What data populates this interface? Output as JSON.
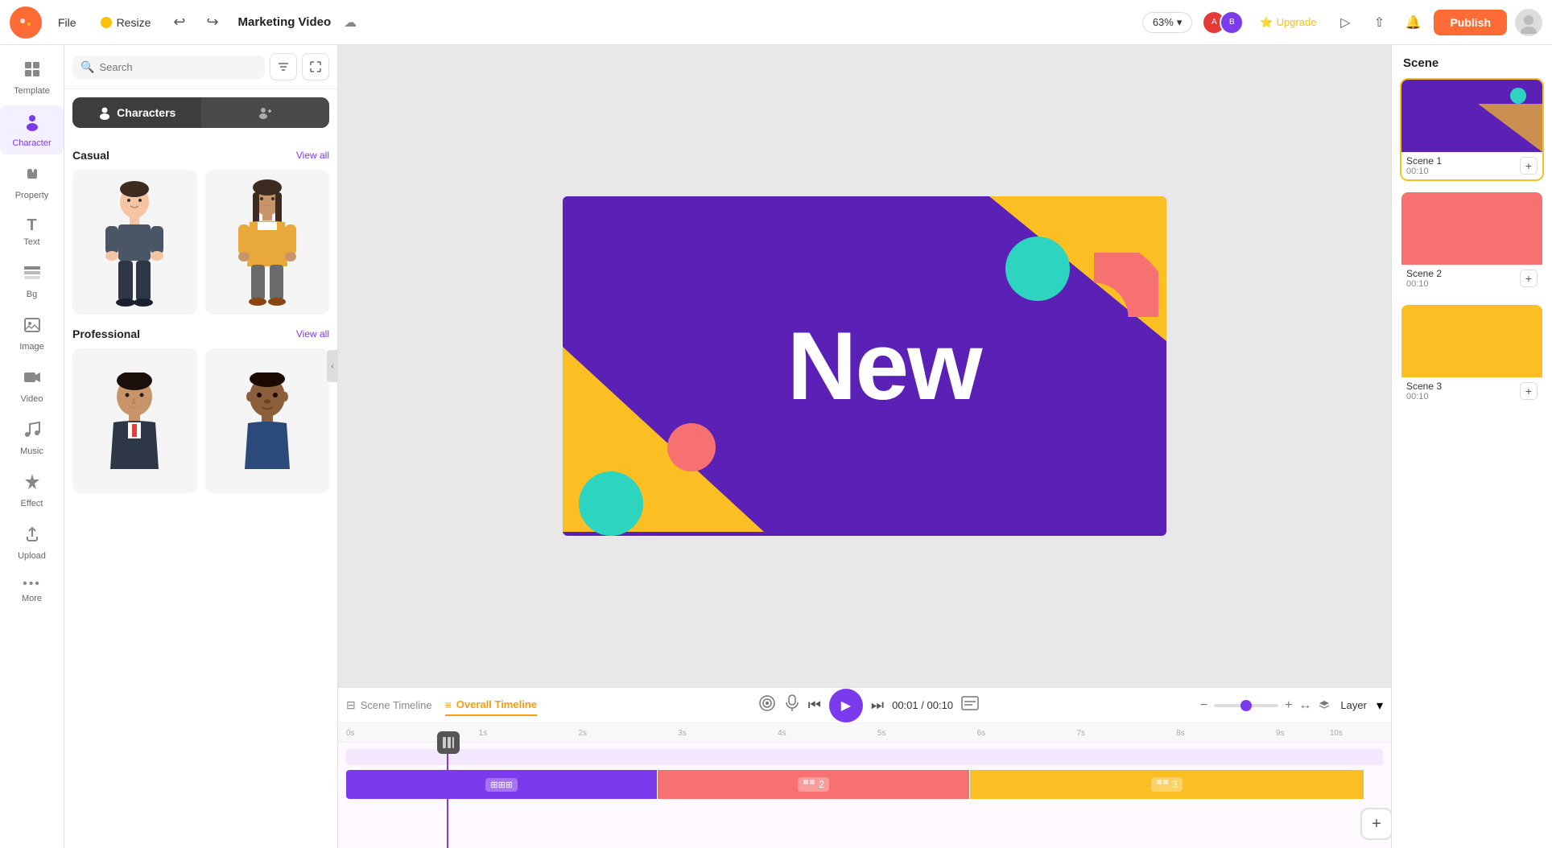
{
  "topbar": {
    "logo": "🎨",
    "file_label": "File",
    "resize_label": "Resize",
    "undo_icon": "↩",
    "redo_icon": "↪",
    "title": "Marketing Video",
    "cloud_icon": "☁",
    "zoom_label": "63%",
    "upgrade_label": "Upgrade",
    "publish_label": "Publish"
  },
  "left_sidebar": {
    "items": [
      {
        "id": "template",
        "label": "Template",
        "icon": "⊞"
      },
      {
        "id": "character",
        "label": "Character",
        "icon": "👤",
        "active": true
      },
      {
        "id": "property",
        "label": "Property",
        "icon": "☕"
      },
      {
        "id": "text",
        "label": "Text",
        "icon": "T"
      },
      {
        "id": "bg",
        "label": "Bg",
        "icon": "🗂"
      },
      {
        "id": "image",
        "label": "Image",
        "icon": "🖼"
      },
      {
        "id": "video",
        "label": "Video",
        "icon": "▶"
      },
      {
        "id": "music",
        "label": "Music",
        "icon": "♪"
      },
      {
        "id": "effect",
        "label": "Effect",
        "icon": "✨"
      },
      {
        "id": "upload",
        "label": "Upload",
        "icon": "☁"
      },
      {
        "id": "more",
        "label": "More",
        "icon": "•••"
      }
    ]
  },
  "panel": {
    "search_placeholder": "Search",
    "tabs": [
      {
        "id": "characters",
        "label": "Characters",
        "icon": "👤",
        "active": true
      },
      {
        "id": "add_character",
        "label": "",
        "icon": "👤+"
      }
    ],
    "sections": [
      {
        "id": "casual",
        "title": "Casual",
        "view_all": "View all",
        "characters": [
          {
            "id": "casual_male",
            "description": "Casual male character"
          },
          {
            "id": "casual_female",
            "description": "Casual female character"
          }
        ]
      },
      {
        "id": "professional",
        "title": "Professional",
        "view_all": "View all",
        "characters": [
          {
            "id": "professional_male1",
            "description": "Professional male character 1"
          },
          {
            "id": "professional_male2",
            "description": "Professional male character 2"
          }
        ]
      }
    ]
  },
  "canvas": {
    "text": "New"
  },
  "timeline": {
    "scene_tab": "Scene Timeline",
    "overall_tab": "Overall Timeline",
    "current_time": "00:01",
    "total_time": "00:10",
    "layer_label": "Layer",
    "scenes": [
      {
        "id": 1,
        "label": "Scene 1"
      },
      {
        "id": 2,
        "label": "Scene 2"
      },
      {
        "id": 3,
        "label": "Scene 3"
      }
    ],
    "ruler_marks": [
      "0s",
      "1s",
      "2s",
      "3s",
      "4s",
      "5s",
      "6s",
      "7s",
      "8s",
      "9s",
      "10s"
    ]
  },
  "right_panel": {
    "title": "Scene",
    "scenes": [
      {
        "id": 1,
        "label": "Scene 1",
        "time": "00:10",
        "active": true,
        "color": "purple"
      },
      {
        "id": 2,
        "label": "Scene 2",
        "time": "00:10",
        "active": false,
        "color": "pink"
      },
      {
        "id": 3,
        "label": "Scene 3",
        "time": "00:10",
        "active": false,
        "color": "yellow"
      }
    ]
  }
}
